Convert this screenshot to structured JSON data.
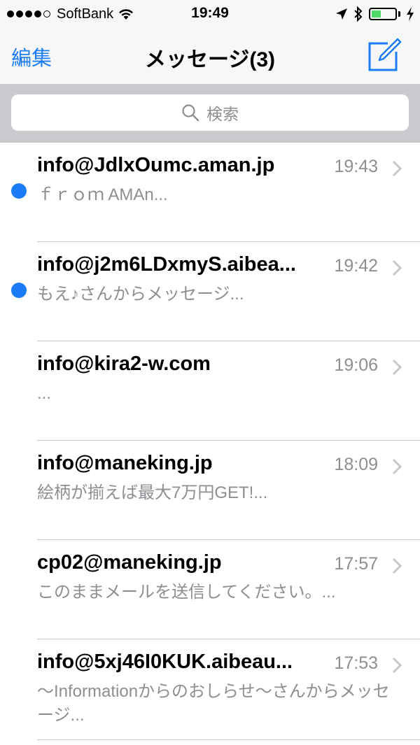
{
  "status_bar": {
    "carrier": "SoftBank",
    "time": "19:49",
    "battery_level": 0.4,
    "battery_color": "#4cd964"
  },
  "nav": {
    "edit_label": "編集",
    "title": "メッセージ(3)",
    "compose_icon": "compose-icon"
  },
  "search": {
    "placeholder": "検索"
  },
  "accent_color": "#1a7cf6",
  "messages": [
    {
      "sender": "info@JdlxOumc.aman.jp",
      "time": "19:43",
      "preview": "ｆｒｏｍ AMAn...",
      "unread": true
    },
    {
      "sender": "info@j2m6LDxmyS.aibea...",
      "time": "19:42",
      "preview": "もえ♪さんからメッセージ...",
      "unread": true
    },
    {
      "sender": "info@kira2-w.com",
      "time": "19:06",
      "preview": "...",
      "unread": false
    },
    {
      "sender": "info@maneking.jp",
      "time": "18:09",
      "preview": "絵柄が揃えば最大7万円GET!...",
      "unread": false
    },
    {
      "sender": "cp02@maneking.jp",
      "time": "17:57",
      "preview": "このままメールを送信してください。...",
      "unread": false
    },
    {
      "sender": "info@5xj46I0KUK.aibeau...",
      "time": "17:53",
      "preview": "〜Informationからのおしらせ〜さんからメッセージ...",
      "unread": false
    }
  ]
}
